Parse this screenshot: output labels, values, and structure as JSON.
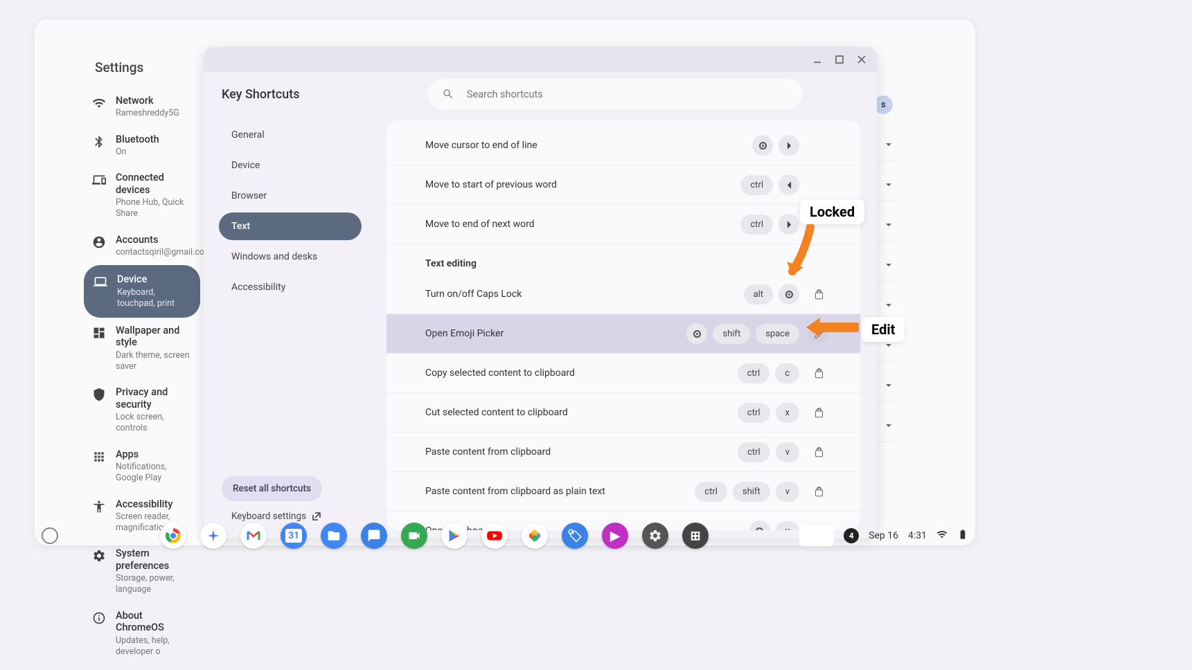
{
  "settings": {
    "title": "Settings",
    "nav": [
      {
        "id": "network",
        "label": "Network",
        "sub": "Rameshreddy5G"
      },
      {
        "id": "bluetooth",
        "label": "Bluetooth",
        "sub": "On"
      },
      {
        "id": "connected",
        "label": "Connected devices",
        "sub": "Phone Hub, Quick Share"
      },
      {
        "id": "accounts",
        "label": "Accounts",
        "sub": "contactsqiril@gmail.com"
      },
      {
        "id": "device",
        "label": "Device",
        "sub": "Keyboard, touchpad, print",
        "active": true
      },
      {
        "id": "wallpaper",
        "label": "Wallpaper and style",
        "sub": "Dark theme, screen saver"
      },
      {
        "id": "privacy",
        "label": "Privacy and security",
        "sub": "Lock screen, controls"
      },
      {
        "id": "apps",
        "label": "Apps",
        "sub": "Notifications, Google Play"
      },
      {
        "id": "accessibility",
        "label": "Accessibility",
        "sub": "Screen reader, magnification"
      },
      {
        "id": "system",
        "label": "System preferences",
        "sub": "Storage, power, language"
      },
      {
        "id": "about",
        "label": "About ChromeOS",
        "sub": "Updates, help, developer o"
      }
    ]
  },
  "shortcuts": {
    "title": "Key Shortcuts",
    "search_placeholder": "Search shortcuts",
    "categories": [
      "General",
      "Device",
      "Browser",
      "Text",
      "Windows and desks",
      "Accessibility"
    ],
    "active_category": "Text",
    "reset_label": "Reset all shortcuts",
    "keyboard_settings_label": "Keyboard settings",
    "top_rows": [
      {
        "label": "Move cursor to end of line",
        "keys": [
          {
            "t": "search"
          },
          {
            "t": "chev-right"
          }
        ]
      },
      {
        "label": "Move to start of previous word",
        "keys": [
          {
            "t": "text",
            "v": "ctrl"
          },
          {
            "t": "chev-left"
          }
        ]
      },
      {
        "label": "Move to end of next word",
        "keys": [
          {
            "t": "text",
            "v": "ctrl"
          },
          {
            "t": "chev-right"
          }
        ]
      }
    ],
    "section_header": "Text editing",
    "rows": [
      {
        "label": "Turn on/off Caps Lock",
        "keys": [
          {
            "t": "text",
            "v": "alt"
          },
          {
            "t": "search"
          }
        ],
        "action": "lock"
      },
      {
        "label": "Open Emoji Picker",
        "keys": [
          {
            "t": "search"
          },
          {
            "t": "text",
            "v": "shift"
          },
          {
            "t": "text",
            "v": "space"
          }
        ],
        "action": "edit",
        "highlight": true
      },
      {
        "label": "Copy selected content to clipboard",
        "keys": [
          {
            "t": "text",
            "v": "ctrl"
          },
          {
            "t": "text",
            "v": "c"
          }
        ],
        "action": "lock"
      },
      {
        "label": "Cut selected content to clipboard",
        "keys": [
          {
            "t": "text",
            "v": "ctrl"
          },
          {
            "t": "text",
            "v": "x"
          }
        ],
        "action": "lock"
      },
      {
        "label": "Paste content from clipboard",
        "keys": [
          {
            "t": "text",
            "v": "ctrl"
          },
          {
            "t": "text",
            "v": "v"
          }
        ],
        "action": "lock"
      },
      {
        "label": "Paste content from clipboard as plain text",
        "keys": [
          {
            "t": "text",
            "v": "ctrl"
          },
          {
            "t": "text",
            "v": "shift"
          },
          {
            "t": "text",
            "v": "v"
          }
        ],
        "action": "lock"
      },
      {
        "label": "Open Clipboard",
        "keys": [
          {
            "t": "search"
          },
          {
            "t": "text",
            "v": "v"
          }
        ],
        "action": "lock"
      }
    ]
  },
  "annotations": {
    "locked": "Locked",
    "edit": "Edit"
  },
  "status": {
    "badge": "4",
    "date": "Sep 16",
    "time": "4:31"
  },
  "peek_badge": "s"
}
